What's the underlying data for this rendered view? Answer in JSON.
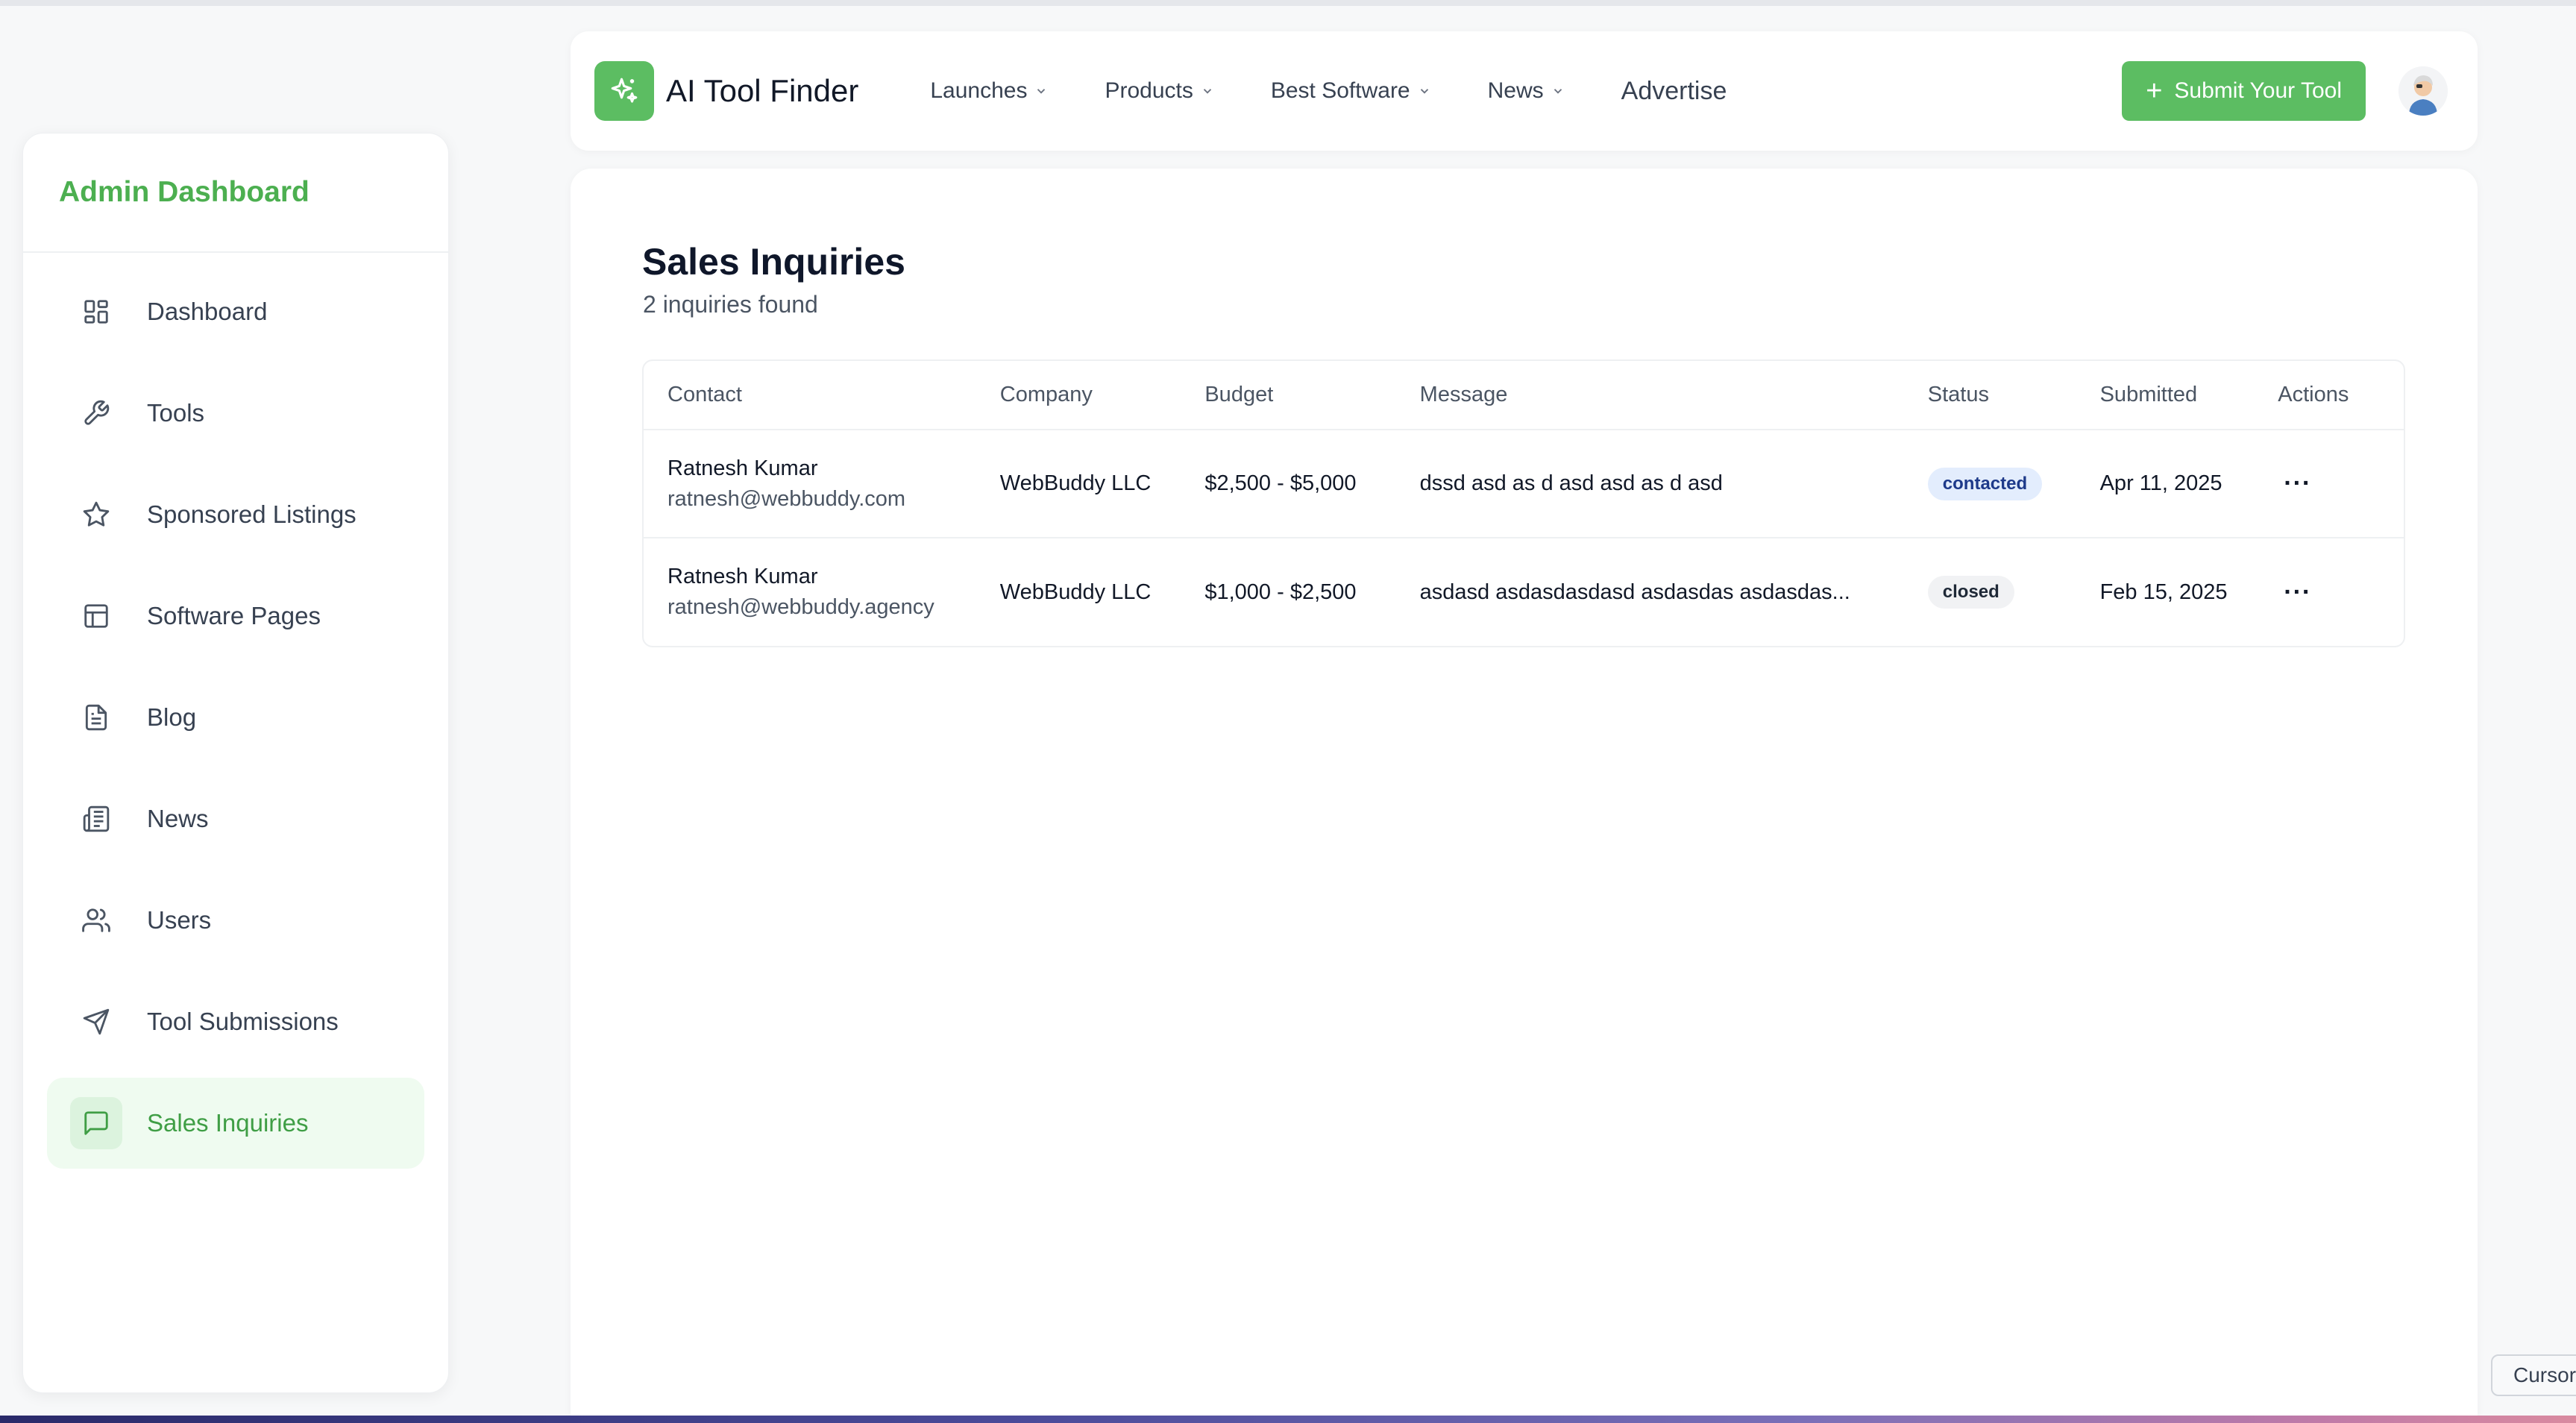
{
  "sidebar": {
    "title": "Admin Dashboard",
    "items": [
      {
        "label": "Dashboard",
        "icon": "dashboard-icon"
      },
      {
        "label": "Tools",
        "icon": "wrench-icon"
      },
      {
        "label": "Sponsored Listings",
        "icon": "star-icon"
      },
      {
        "label": "Software Pages",
        "icon": "layout-icon"
      },
      {
        "label": "Blog",
        "icon": "document-icon"
      },
      {
        "label": "News",
        "icon": "newspaper-icon"
      },
      {
        "label": "Users",
        "icon": "users-icon"
      },
      {
        "label": "Tool Submissions",
        "icon": "send-icon"
      },
      {
        "label": "Sales Inquiries",
        "icon": "message-icon",
        "active": true
      }
    ]
  },
  "header": {
    "brand": "AI Tool Finder",
    "nav": [
      "Launches",
      "Products",
      "Best Software",
      "News"
    ],
    "advertise": "Advertise",
    "submit_label": "Submit Your Tool"
  },
  "main": {
    "title": "Sales Inquiries",
    "subtitle": "2 inquiries found",
    "columns": [
      "Contact",
      "Company",
      "Budget",
      "Message",
      "Status",
      "Submitted",
      "Actions"
    ],
    "rows": [
      {
        "name": "Ratnesh Kumar",
        "email": "ratnesh@webbuddy.com",
        "company": "WebBuddy LLC",
        "budget": "$2,500 - $5,000",
        "message": "dssd asd as d asd asd as d asd",
        "status": "contacted",
        "submitted": "Apr 11, 2025",
        "actions": "···"
      },
      {
        "name": "Ratnesh Kumar",
        "email": "ratnesh@webbuddy.agency",
        "company": "WebBuddy LLC",
        "budget": "$1,000 - $2,500",
        "message": "asdasd asdasdasdasd asdasdas asdasdas...",
        "status": "closed",
        "submitted": "Feb 15, 2025",
        "actions": "···"
      }
    ]
  },
  "tooltip": "Cursor",
  "colors": {
    "accent": "#5cbd62",
    "sidebar_title": "#4caf50",
    "contacted_bg": "#e3edfd",
    "closed_bg": "#f1f2f4"
  }
}
